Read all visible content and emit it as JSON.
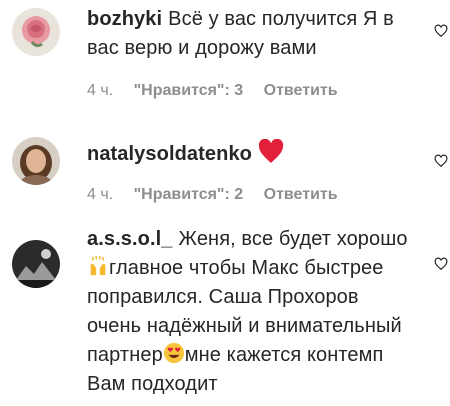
{
  "comments": [
    {
      "username": "bozhyki",
      "text": "Всё у вас получится Я в вас верю и дорожу вами",
      "time": "4 ч.",
      "likes": "\"Нравится\": 3",
      "reply": "Ответить",
      "avatar_icon": "rose-avatar",
      "like_icon": "heart-outline-icon"
    },
    {
      "username": "natalysoldatenko",
      "text": "",
      "emoji": "red-heart-emoji",
      "time": "4 ч.",
      "likes": "\"Нравится\": 2",
      "reply": "Ответить",
      "avatar_icon": "woman-avatar",
      "like_icon": "heart-outline-icon"
    },
    {
      "username": "a.s.s.o.l_",
      "text_part1": "Женя, все будет хорошо",
      "text_part2": "главное чтобы Макс быстрее поправился. Саша Прохоров очень надёжный и внимательный партнер",
      "text_part3": "мне кажется контемп Вам подходит",
      "emoji1": "raising-hands-emoji",
      "emoji2": "heart-eyes-emoji",
      "avatar_icon": "dark-photo-avatar",
      "like_icon": "heart-outline-icon"
    }
  ],
  "colors": {
    "text": "#262626",
    "meta": "#8e8e8e",
    "heart": "#ed4956"
  }
}
